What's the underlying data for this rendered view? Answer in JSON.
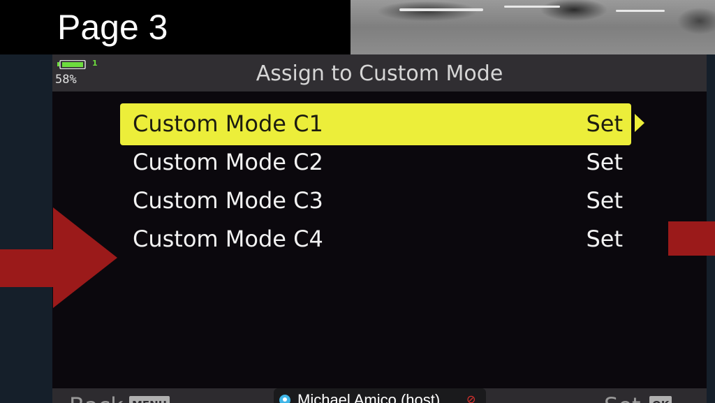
{
  "slide": {
    "title": "Page 3"
  },
  "camera_menu": {
    "title": "Assign to Custom Mode",
    "battery_percent": "58%",
    "card_number": "1",
    "items": [
      {
        "label": "Custom Mode C1",
        "value": "Set",
        "selected": true
      },
      {
        "label": "Custom Mode C2",
        "value": "Set",
        "selected": false
      },
      {
        "label": "Custom Mode C3",
        "value": "Set",
        "selected": false
      },
      {
        "label": "Custom Mode C4",
        "value": "Set",
        "selected": false
      }
    ],
    "footer": {
      "back_label": "Back",
      "back_key": "MENU",
      "set_label": "Set",
      "set_key": "OK"
    }
  },
  "meeting": {
    "host_label": "Michael Amico (host)"
  },
  "colors": {
    "highlight": "#ecee3a",
    "annotation_red": "#9b1a1a",
    "menu_bg": "#0b080d",
    "header_bg": "#302e32"
  },
  "icons": [
    "battery-icon",
    "arrow-right-icon",
    "participant-icon",
    "mic-muted-icon"
  ]
}
